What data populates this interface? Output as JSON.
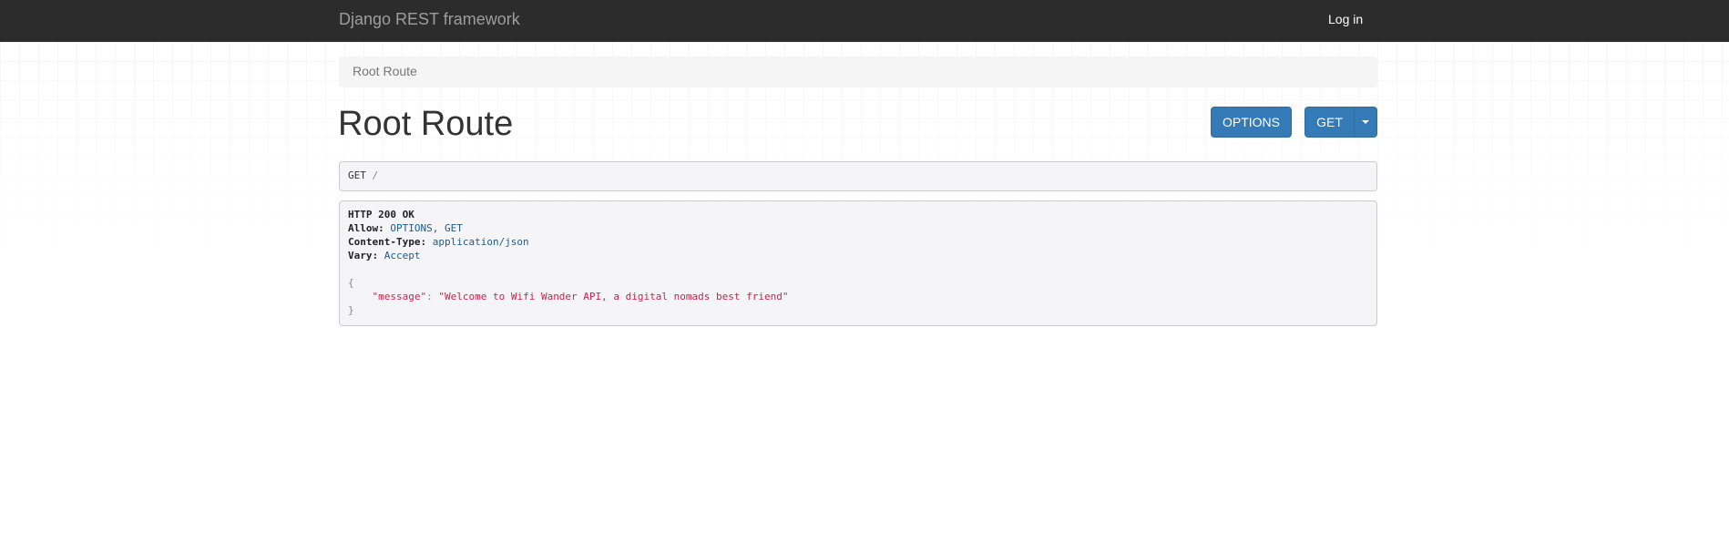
{
  "navbar": {
    "brand": "Django REST framework",
    "login": "Log in"
  },
  "breadcrumb": {
    "label": "Root Route"
  },
  "page": {
    "title": "Root Route"
  },
  "toolbar": {
    "options_label": "OPTIONS",
    "get_label": "GET"
  },
  "request": {
    "method": "GET",
    "path": "/"
  },
  "response": {
    "status_line": "HTTP 200 OK",
    "headers": [
      {
        "name": "Allow:",
        "value": "OPTIONS, GET"
      },
      {
        "name": "Content-Type:",
        "value": "application/json"
      },
      {
        "name": "Vary:",
        "value": "Accept"
      }
    ],
    "body": {
      "open": "{",
      "key": "\"message\"",
      "sep": ": ",
      "value": "\"Welcome to Wifi Wander API, a digital nomads best friend\"",
      "close": "}"
    }
  },
  "colors": {
    "navbar_bg": "#2c2c2c",
    "primary": "#337ab7",
    "string": "#c7254e"
  }
}
